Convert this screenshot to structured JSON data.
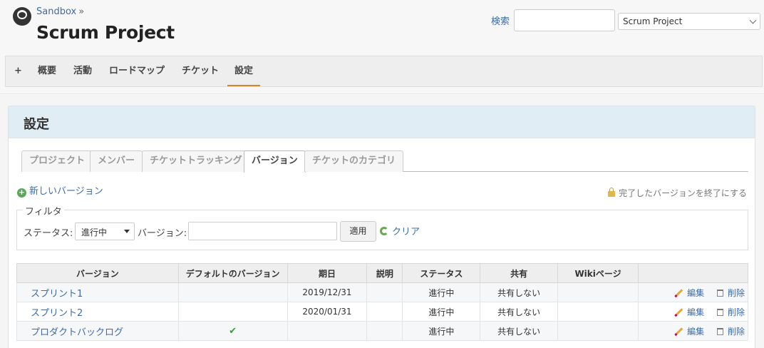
{
  "header": {
    "breadcrumb": "Sandbox",
    "breadcrumb_sep": "»",
    "project_title": "Scrum Project",
    "search_label": "検索",
    "search_value": "",
    "project_select": "Scrum Project"
  },
  "menu": {
    "items": [
      "+",
      "概要",
      "活動",
      "ロードマップ",
      "チケット",
      "設定"
    ],
    "selected": "設定"
  },
  "content": {
    "title": "設定",
    "tabs": [
      "プロジェクト",
      "メンバー",
      "チケットトラッキング",
      "バージョン",
      "チケットのカテゴリ"
    ],
    "selected_tab": "バージョン",
    "new_version": "新しいバージョン",
    "close_completed": "完了したバージョンを終了にする",
    "filters": {
      "legend": "フィルタ",
      "status_label": "ステータス:",
      "status_value": "進行中",
      "version_label": "バージョン:",
      "version_value": "",
      "apply": "適用",
      "clear": "クリア"
    },
    "table": {
      "headers": [
        "バージョン",
        "デフォルトのバージョン",
        "期日",
        "説明",
        "ステータス",
        "共有",
        "Wikiページ",
        ""
      ],
      "rows": [
        {
          "name": "スプリント1",
          "default": "",
          "due": "2019/12/31",
          "desc": "",
          "status": "進行中",
          "sharing": "共有しない",
          "wiki": "",
          "edit": "編集",
          "delete": "削除"
        },
        {
          "name": "スプリント2",
          "default": "",
          "due": "2020/01/31",
          "desc": "",
          "status": "進行中",
          "sharing": "共有しない",
          "wiki": "",
          "edit": "編集",
          "delete": "削除"
        },
        {
          "name": "プロダクトバックログ",
          "default": "✔",
          "due": "",
          "desc": "",
          "status": "進行中",
          "sharing": "共有しない",
          "wiki": "",
          "edit": "編集",
          "delete": "削除"
        }
      ]
    }
  },
  "colors": {
    "link": "#3e6ba8",
    "menu_selected_underline": "#d6852b",
    "content_header_bg": "#e1edf5",
    "check": "#3a9c3a"
  }
}
